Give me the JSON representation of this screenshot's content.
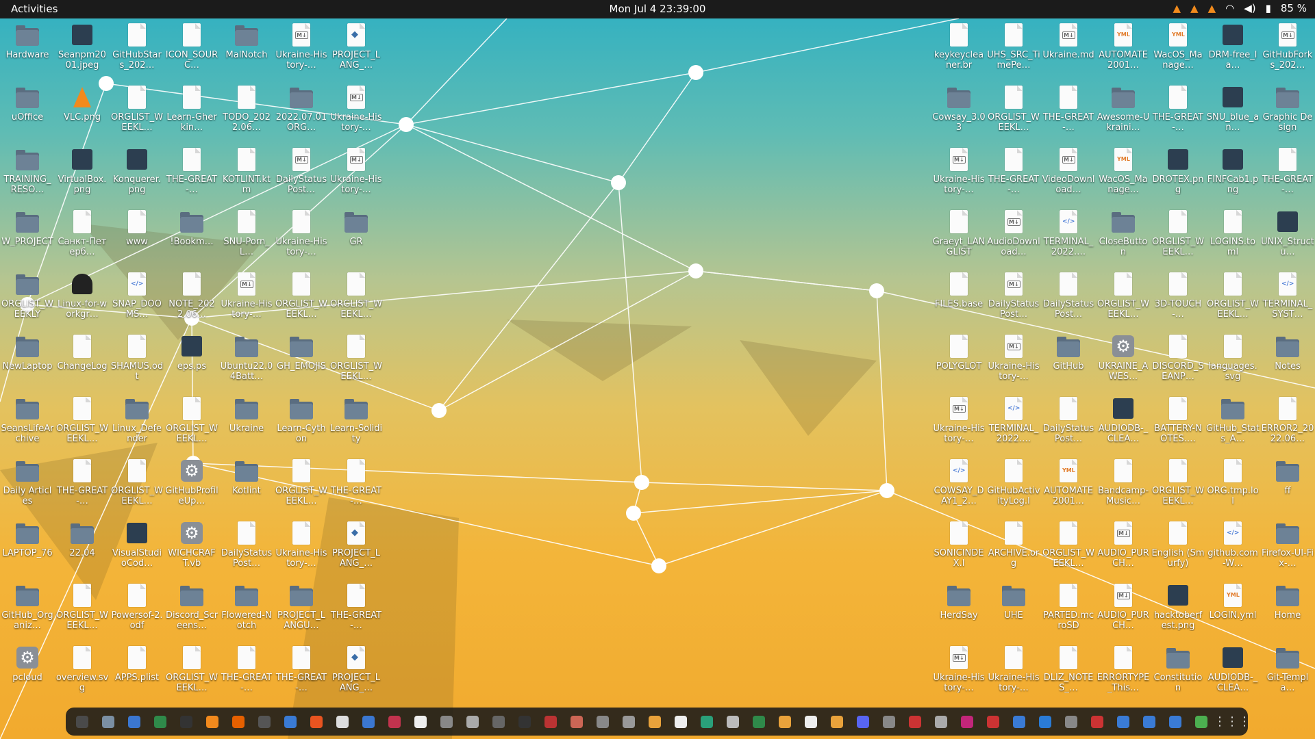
{
  "topbar": {
    "activities": "Activities",
    "clock": "Mon Jul 4  23:39:00",
    "battery": "85 %",
    "tray_icons": [
      "vlc-cone-icon",
      "vlc-cone-icon",
      "vlc-cone-icon",
      "wifi-icon",
      "volume-icon",
      "battery-icon"
    ]
  },
  "desktop_left": [
    {
      "label": "Hardware",
      "type": "folder"
    },
    {
      "label": "Seanpm2001.jpeg",
      "type": "img"
    },
    {
      "label": "GitHubStars_202…",
      "type": "doc"
    },
    {
      "label": "ICON_SOURC…",
      "type": "doc"
    },
    {
      "label": "MalNotch",
      "type": "folder"
    },
    {
      "label": "Ukraine-History-…",
      "type": "md"
    },
    {
      "label": "PROJECT_LANG_…",
      "type": "py"
    },
    {
      "label": "uOffice",
      "type": "folder"
    },
    {
      "label": "VLC.png",
      "type": "vlc"
    },
    {
      "label": "ORGLIST_WEEKL…",
      "type": "doc"
    },
    {
      "label": "Learn-Gherkin…",
      "type": "doc"
    },
    {
      "label": "TODO_2022.06…",
      "type": "doc"
    },
    {
      "label": "2022.07.01ORG…",
      "type": "folder"
    },
    {
      "label": "Ukraine-History-…",
      "type": "md"
    },
    {
      "label": "TRAINING_RESO…",
      "type": "folder"
    },
    {
      "label": "VirtualBox.png",
      "type": "img"
    },
    {
      "label": "Konquerer.png",
      "type": "img"
    },
    {
      "label": "THE-GREAT-…",
      "type": "doc"
    },
    {
      "label": "KOTLINT.ktm",
      "type": "doc"
    },
    {
      "label": "DailyStatusPost…",
      "type": "md"
    },
    {
      "label": "Ukraine-History-…",
      "type": "md"
    },
    {
      "label": "W_PROJECT",
      "type": "folder"
    },
    {
      "label": "Санкт-Петерб…",
      "type": "doc"
    },
    {
      "label": "www",
      "type": "doc"
    },
    {
      "label": "!Bookm…",
      "type": "folder"
    },
    {
      "label": "SNU-Porn_L…",
      "type": "doc"
    },
    {
      "label": "Ukraine-History-…",
      "type": "doc"
    },
    {
      "label": "GR",
      "type": "folder"
    },
    {
      "label": "ORGLIST_WEEKLY",
      "type": "folder"
    },
    {
      "label": "Linux-for-workgr…",
      "type": "tux"
    },
    {
      "label": "SNAP_DOOMS…",
      "type": "code"
    },
    {
      "label": "NOTE_2022.06…",
      "type": "doc"
    },
    {
      "label": "Ukraine-History-…",
      "type": "md"
    },
    {
      "label": "ORGLIST_WEEKL…",
      "type": "doc"
    },
    {
      "label": "ORGLIST_WEEKL…",
      "type": "doc"
    },
    {
      "label": "NewLaptop",
      "type": "folder"
    },
    {
      "label": "ChangeLog",
      "type": "doc"
    },
    {
      "label": "SHAMUS.odt",
      "type": "doc"
    },
    {
      "label": "eps.ps",
      "type": "img"
    },
    {
      "label": "Ubuntu22.04Batt…",
      "type": "folder"
    },
    {
      "label": "GH_EMOJIS",
      "type": "folder"
    },
    {
      "label": "ORGLIST_WEEKL…",
      "type": "doc"
    },
    {
      "label": "SeansLifeArchive",
      "type": "folder"
    },
    {
      "label": "ORGLIST_WEEKL…",
      "type": "doc"
    },
    {
      "label": "Linux_Defender",
      "type": "folder"
    },
    {
      "label": "ORGLIST_WEEKL…",
      "type": "doc"
    },
    {
      "label": "Ukraine",
      "type": "folder"
    },
    {
      "label": "Learn-Cython",
      "type": "folder"
    },
    {
      "label": "Learn-Solidity",
      "type": "folder"
    },
    {
      "label": "Daily Articles",
      "type": "folder"
    },
    {
      "label": "THE-GREAT-…",
      "type": "doc"
    },
    {
      "label": "ORGLIST_WEEKL…",
      "type": "doc"
    },
    {
      "label": "GitHubProfileUp…",
      "type": "gear"
    },
    {
      "label": "Kotlint",
      "type": "folder"
    },
    {
      "label": "ORGLIST_WEEKL…",
      "type": "doc"
    },
    {
      "label": "THE-GREAT-…",
      "type": "doc"
    },
    {
      "label": "LAPTOP_76",
      "type": "folder"
    },
    {
      "label": "22.04",
      "type": "folder"
    },
    {
      "label": "VisualStudioCod…",
      "type": "img"
    },
    {
      "label": "WICHCRAFT.vb",
      "type": "gear"
    },
    {
      "label": "DailyStatusPost…",
      "type": "doc"
    },
    {
      "label": "Ukraine-History-…",
      "type": "doc"
    },
    {
      "label": "PROJECT_LANG_…",
      "type": "py"
    },
    {
      "label": "GitHub_Organiz…",
      "type": "folder"
    },
    {
      "label": "ORGLIST_WEEKL…",
      "type": "doc"
    },
    {
      "label": "Powersof-2.odf",
      "type": "doc"
    },
    {
      "label": "Discord_Screens…",
      "type": "folder"
    },
    {
      "label": "Flowered-Notch",
      "type": "folder"
    },
    {
      "label": "PROJECT_LANGU…",
      "type": "folder"
    },
    {
      "label": "THE-GREAT-…",
      "type": "doc"
    },
    {
      "label": "pcloud",
      "type": "gear"
    },
    {
      "label": "overview.svg",
      "type": "doc"
    },
    {
      "label": "APPS.plist",
      "type": "doc"
    },
    {
      "label": "ORGLIST_WEEKL…",
      "type": "doc"
    },
    {
      "label": "THE-GREAT-…",
      "type": "doc"
    },
    {
      "label": "THE-GREAT-…",
      "type": "doc"
    },
    {
      "label": "PROJECT_LANG_…",
      "type": "py"
    }
  ],
  "desktop_right": [
    {
      "label": "keykeycleaner.br",
      "type": "doc"
    },
    {
      "label": "UHS_SRC_TimePe…",
      "type": "doc"
    },
    {
      "label": "Ukraine.md",
      "type": "md"
    },
    {
      "label": "AUTOMATE2001…",
      "type": "yml"
    },
    {
      "label": "WacOS_Manage…",
      "type": "yml"
    },
    {
      "label": "DRM-free_la…",
      "type": "img"
    },
    {
      "label": "GitHubForks_202…",
      "type": "md"
    },
    {
      "label": "Cowsay_3.03",
      "type": "folder"
    },
    {
      "label": "ORGLIST_WEEKL…",
      "type": "doc"
    },
    {
      "label": "THE-GREAT-…",
      "type": "doc"
    },
    {
      "label": "Awesome-Ukraini…",
      "type": "folder"
    },
    {
      "label": "THE-GREAT-…",
      "type": "doc"
    },
    {
      "label": "SNU_blue_an…",
      "type": "img"
    },
    {
      "label": "Graphic Design",
      "type": "folder"
    },
    {
      "label": "Ukraine-History-…",
      "type": "md"
    },
    {
      "label": "THE-GREAT-…",
      "type": "doc"
    },
    {
      "label": "VideoDownload…",
      "type": "md"
    },
    {
      "label": "WacOS_Manage…",
      "type": "yml"
    },
    {
      "label": "DROTEX.png",
      "type": "img"
    },
    {
      "label": "FINFCab1.png",
      "type": "img"
    },
    {
      "label": "THE-GREAT-…",
      "type": "doc"
    },
    {
      "label": "Graeyt_LANGLIST",
      "type": "doc"
    },
    {
      "label": "AudioDownload…",
      "type": "md"
    },
    {
      "label": "TERMINAL_2022.…",
      "type": "code"
    },
    {
      "label": "CloseButton",
      "type": "folder"
    },
    {
      "label": "ORGLIST_WEEKL…",
      "type": "doc"
    },
    {
      "label": "LOGINS.toml",
      "type": "doc"
    },
    {
      "label": "UNIX_Structu…",
      "type": "img"
    },
    {
      "label": "FILES.base",
      "type": "doc"
    },
    {
      "label": "DailyStatusPost…",
      "type": "md"
    },
    {
      "label": "DailyStatusPost…",
      "type": "doc"
    },
    {
      "label": "ORGLIST_WEEKL…",
      "type": "doc"
    },
    {
      "label": "3D-TOUCH-…",
      "type": "doc"
    },
    {
      "label": "ORGLIST_WEEKL…",
      "type": "doc"
    },
    {
      "label": "TERMINAL_SYST…",
      "type": "code"
    },
    {
      "label": "POLYGLOT",
      "type": "doc"
    },
    {
      "label": "Ukraine-History-…",
      "type": "md"
    },
    {
      "label": "GitHub",
      "type": "folder"
    },
    {
      "label": "UKRAINE_AWES…",
      "type": "gear"
    },
    {
      "label": "DISCORD_SEANP…",
      "type": "doc"
    },
    {
      "label": "languages.svg",
      "type": "doc"
    },
    {
      "label": "Notes",
      "type": "folder"
    },
    {
      "label": "Ukraine-History-…",
      "type": "md"
    },
    {
      "label": "TERMINAL_2022.…",
      "type": "code"
    },
    {
      "label": "DailyStatusPost…",
      "type": "doc"
    },
    {
      "label": "AUDIODB-_CLEA…",
      "type": "img"
    },
    {
      "label": "BATTERY-NOTES.…",
      "type": "doc"
    },
    {
      "label": "GitHub_Stats_A…",
      "type": "folder"
    },
    {
      "label": "ERROR2_2022.06…",
      "type": "doc"
    },
    {
      "label": "COWSAY_DAY1_2…",
      "type": "code"
    },
    {
      "label": "GitHubActivityLog.l",
      "type": "doc"
    },
    {
      "label": "AUTOMATE2001…",
      "type": "yml"
    },
    {
      "label": "Bandcamp-Music…",
      "type": "doc"
    },
    {
      "label": "ORGLIST_WEEKL…",
      "type": "doc"
    },
    {
      "label": "ORG.tmp.lol",
      "type": "doc"
    },
    {
      "label": "ff",
      "type": "folder"
    },
    {
      "label": "SONICINDEX.l",
      "type": "doc"
    },
    {
      "label": "ARCHIVE.org",
      "type": "doc"
    },
    {
      "label": "ORGLIST_WEEKL…",
      "type": "doc"
    },
    {
      "label": "AUDIO_PURCH…",
      "type": "md"
    },
    {
      "label": "English (Smurfy)",
      "type": "doc"
    },
    {
      "label": "github.com-W…",
      "type": "code"
    },
    {
      "label": "Firefox-UI-Fix-…",
      "type": "folder"
    },
    {
      "label": "HerdSay",
      "type": "folder"
    },
    {
      "label": "UHE",
      "type": "folder"
    },
    {
      "label": "PARTED.mcroSD",
      "type": "doc"
    },
    {
      "label": "AUDIO_PURCH…",
      "type": "md"
    },
    {
      "label": "hacktoberfest.png",
      "type": "img"
    },
    {
      "label": "LOGIN.yml",
      "type": "yml"
    },
    {
      "label": "Home",
      "type": "folder"
    },
    {
      "label": "Ukraine-History-…",
      "type": "md"
    },
    {
      "label": "Ukraine-History-…",
      "type": "doc"
    },
    {
      "label": "DLIZ_NOTES_…",
      "type": "doc"
    },
    {
      "label": "ERRORTYPE_This…",
      "type": "doc"
    },
    {
      "label": "Constitution",
      "type": "folder"
    },
    {
      "label": "AUDIODB-_CLEA…",
      "type": "img"
    },
    {
      "label": "Git-Templa…",
      "type": "folder"
    }
  ],
  "dock": {
    "apps": [
      {
        "name": "terminal",
        "color": "#4a4a4a"
      },
      {
        "name": "files",
        "color": "#7b8fa3"
      },
      {
        "name": "text-editor",
        "color": "#3b77d1"
      },
      {
        "name": "libreoffice",
        "color": "#2f8a4a"
      },
      {
        "name": "terminal-2",
        "color": "#333"
      },
      {
        "name": "vlc",
        "color": "#f28a1d"
      },
      {
        "name": "firefox",
        "color": "#e66000"
      },
      {
        "name": "obs",
        "color": "#555"
      },
      {
        "name": "help",
        "color": "#3a7bd5"
      },
      {
        "name": "software-store",
        "color": "#e95420"
      },
      {
        "name": "notes",
        "color": "#ddd"
      },
      {
        "name": "writer",
        "color": "#3b77d1"
      },
      {
        "name": "system-monitor",
        "color": "#c2334e"
      },
      {
        "name": "document",
        "color": "#eee"
      },
      {
        "name": "cursor",
        "color": "#888"
      },
      {
        "name": "box",
        "color": "#aaa"
      },
      {
        "name": "obs-studio",
        "color": "#666"
      },
      {
        "name": "inkscape",
        "color": "#333"
      },
      {
        "name": "game",
        "color": "#b33"
      },
      {
        "name": "avatar",
        "color": "#c65"
      },
      {
        "name": "phone",
        "color": "#888"
      },
      {
        "name": "screenshot",
        "color": "#999"
      },
      {
        "name": "chrome",
        "color": "#e9a23b"
      },
      {
        "name": "editor",
        "color": "#eee"
      },
      {
        "name": "terminal-3",
        "color": "#2aa07a"
      },
      {
        "name": "disks",
        "color": "#bbb"
      },
      {
        "name": "spreadsheet",
        "color": "#2f8a4a"
      },
      {
        "name": "archive",
        "color": "#e9a23b"
      },
      {
        "name": "clipboard",
        "color": "#eee"
      },
      {
        "name": "presentation",
        "color": "#e9a23b"
      },
      {
        "name": "discord",
        "color": "#5865f2"
      },
      {
        "name": "steam",
        "color": "#888"
      },
      {
        "name": "image-viewer",
        "color": "#c33"
      },
      {
        "name": "symbols",
        "color": "#aaa"
      },
      {
        "name": "media",
        "color": "#c3267a"
      },
      {
        "name": "calendar",
        "color": "#c33"
      },
      {
        "name": "browser",
        "color": "#3a7bd5"
      },
      {
        "name": "vscode",
        "color": "#2a7bd5"
      },
      {
        "name": "ubuntu",
        "color": "#888"
      },
      {
        "name": "bookmark",
        "color": "#c33"
      },
      {
        "name": "cards",
        "color": "#3a7bd5"
      },
      {
        "name": "screen",
        "color": "#3a7bd5"
      },
      {
        "name": "store",
        "color": "#3a7bd5"
      },
      {
        "name": "trash",
        "color": "#4caf50"
      }
    ],
    "show_apps_icon": "grid-icon"
  },
  "wallpaper": {
    "primary_colors": [
      "#2fb0c2",
      "#e3c25f",
      "#f2aa2e"
    ],
    "network_node_color": "#ffffff"
  }
}
